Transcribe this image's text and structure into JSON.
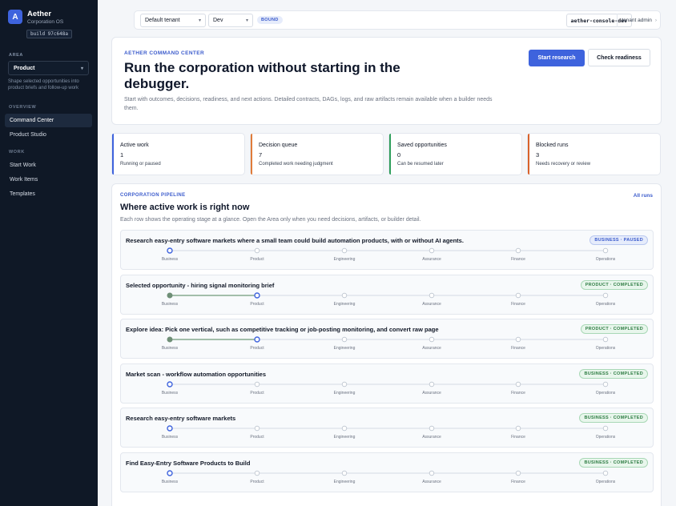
{
  "sidebar": {
    "brand_initial": "A",
    "brand_name": "Aether",
    "brand_sub": "Corporation OS",
    "build": "build 97c648a",
    "area_label": "AREA",
    "area_value": "Product",
    "area_desc": "Shape selected opportunities into product briefs and follow-up work",
    "overview_label": "OVERVIEW",
    "work_label": "WORK",
    "items": [
      {
        "label": "Command Center",
        "active": true
      },
      {
        "label": "Product Studio",
        "active": false
      },
      {
        "label": "Start Work",
        "active": false
      },
      {
        "label": "Work Items",
        "active": false
      },
      {
        "label": "Templates",
        "active": false
      }
    ]
  },
  "topbar": {
    "tenant": "Default tenant",
    "env": "Dev",
    "bound": "BOUND",
    "console": "aether-console-dev",
    "user": "tenant admin",
    "user_chevron": "›"
  },
  "hero": {
    "kicker": "AETHER COMMAND CENTER",
    "title": "Run the corporation without starting in the debugger.",
    "desc": "Start with outcomes, decisions, readiness, and next actions. Detailed contracts, DAGs, logs, and raw artifacts remain available when a builder needs them.",
    "primary": "Start research",
    "secondary": "Check readiness"
  },
  "stats": [
    {
      "label": "Active work",
      "value": "1",
      "sub": "Running or paused",
      "color": "#3e63dd"
    },
    {
      "label": "Decision queue",
      "value": "7",
      "sub": "Completed work needing judgment",
      "color": "#e07b39"
    },
    {
      "label": "Saved opportunities",
      "value": "0",
      "sub": "Can be resumed later",
      "color": "#2f9e5b"
    },
    {
      "label": "Blocked runs",
      "value": "3",
      "sub": "Needs recovery or review",
      "color": "#d9622b"
    }
  ],
  "pipeline": {
    "kicker": "CORPORATION PIPELINE",
    "all_runs": "All runs",
    "title": "Where active work is right now",
    "desc": "Each row shows the operating stage at a glance. Open the Area only when you need decisions, artifacts, or builder detail.",
    "stages": [
      "Business",
      "Product",
      "Engineering",
      "Assurance",
      "Finance",
      "Operations"
    ],
    "runs": [
      {
        "title": "Research easy-entry software markets where a small team could build automation products, with or without AI agents.",
        "badge": "BUSINESS · PAUSED",
        "status": "paused",
        "current": 0
      },
      {
        "title": "Selected opportunity - hiring signal monitoring brief",
        "badge": "PRODUCT · COMPLETED",
        "status": "completed",
        "current": 1
      },
      {
        "title": "Explore idea: Pick one vertical, such as competitive tracking or job-posting monitoring, and convert raw page",
        "badge": "PRODUCT · COMPLETED",
        "status": "completed",
        "current": 1
      },
      {
        "title": "Market scan - workflow automation opportunities",
        "badge": "BUSINESS · COMPLETED",
        "status": "completed",
        "current": 0
      },
      {
        "title": "Research easy-entry software markets",
        "badge": "BUSINESS · COMPLETED",
        "status": "completed",
        "current": 0
      },
      {
        "title": "Find Easy-Entry Software Products to Build",
        "badge": "BUSINESS · COMPLETED",
        "status": "completed",
        "current": 0
      }
    ]
  }
}
